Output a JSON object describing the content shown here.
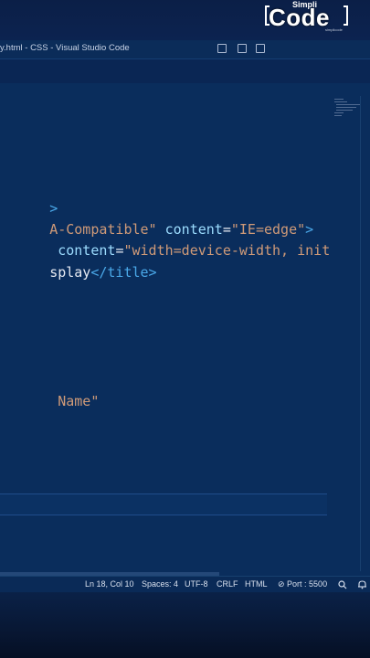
{
  "window": {
    "title": "y.html - CSS - Visual Studio Code"
  },
  "brand": {
    "small": "Simpli",
    "big": "Code",
    "tiny": "simplicode"
  },
  "editor": {
    "lines": [
      {
        "parts": [
          {
            "t": "tag",
            "v": ">"
          }
        ]
      },
      {
        "parts": [
          {
            "t": "str",
            "v": "A-Compatible\""
          },
          {
            "t": "txt",
            "v": " "
          },
          {
            "t": "attr",
            "v": "content"
          },
          {
            "t": "txt",
            "v": "="
          },
          {
            "t": "str",
            "v": "\"IE=edge\""
          },
          {
            "t": "tag",
            "v": ">"
          }
        ]
      },
      {
        "parts": [
          {
            "t": "txt",
            "v": " "
          },
          {
            "t": "attr",
            "v": "content"
          },
          {
            "t": "txt",
            "v": "="
          },
          {
            "t": "str",
            "v": "\"width=device-width, initial"
          }
        ]
      },
      {
        "parts": [
          {
            "t": "txt",
            "v": "splay"
          },
          {
            "t": "tag",
            "v": "</title>"
          }
        ]
      },
      {
        "parts": [
          {
            "t": "str",
            "v": " Name\""
          }
        ]
      }
    ]
  },
  "statusbar": {
    "position": "Ln 18, Col 10",
    "spaces": "Spaces: 4",
    "encoding": "UTF-8",
    "eol": "CRLF",
    "language": "HTML",
    "port": "⊘ Port : 5500"
  }
}
